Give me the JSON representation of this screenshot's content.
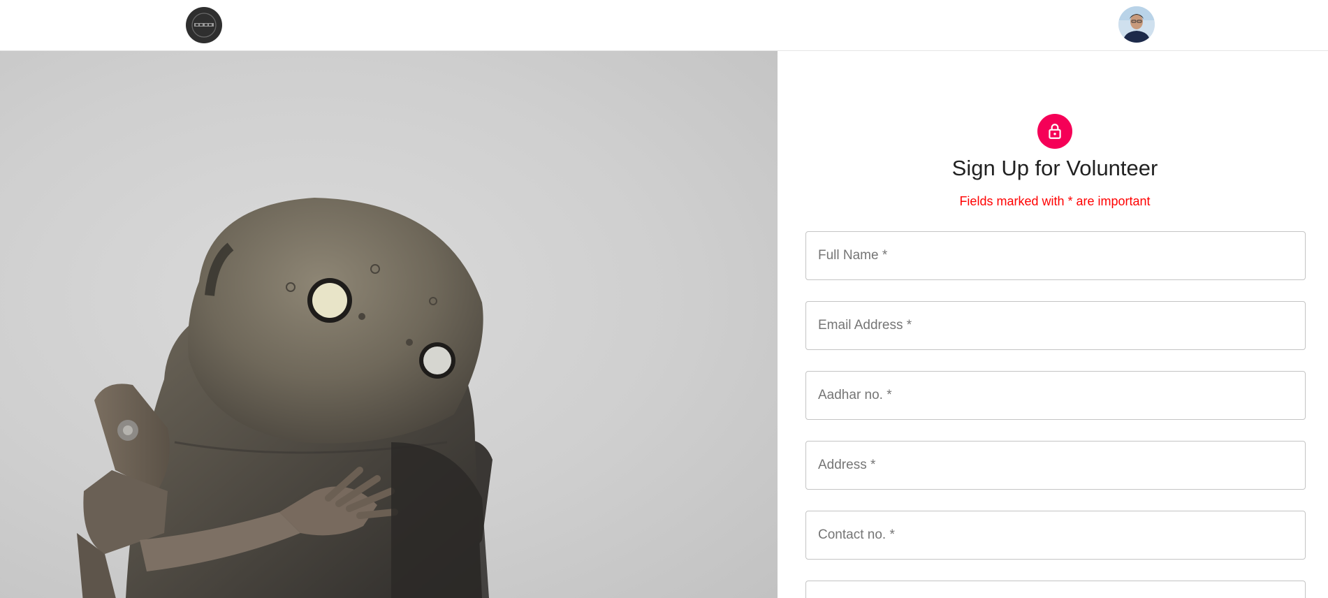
{
  "header": {
    "logo_icon": "brand-logo-icon",
    "avatar_icon": "user-avatar-icon"
  },
  "hero": {
    "image_icon": "robot-illustration-icon"
  },
  "form": {
    "lock_icon": "lock-open-icon",
    "accent_color": "#f50057",
    "note_color": "#ff0000",
    "title": "Sign Up for Volunteer",
    "note": "Fields marked with * are important",
    "fields": [
      {
        "placeholder": "Full Name *",
        "value": ""
      },
      {
        "placeholder": "Email Address *",
        "value": ""
      },
      {
        "placeholder": "Aadhar no. *",
        "value": ""
      },
      {
        "placeholder": "Address *",
        "value": ""
      },
      {
        "placeholder": "Contact no. *",
        "value": ""
      },
      {
        "placeholder": "",
        "value": ""
      }
    ]
  }
}
